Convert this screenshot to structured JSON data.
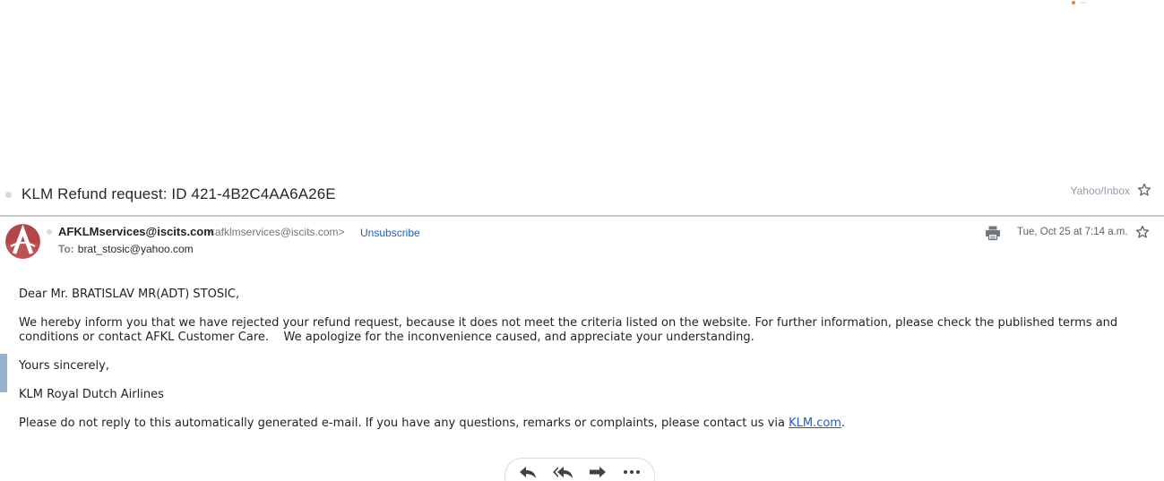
{
  "message": {
    "subject": "KLM Refund request: ID 421-4B2C4AA6A26E",
    "folder": "Yahoo/Inbox",
    "sender_name": "AFKLMservices@iscits.com",
    "sender_email": "<afklmservices@iscits.com>",
    "unsubscribe_label": "Unsubscribe",
    "to_label": "To:",
    "to_address": "brat_stosic@yahoo.com",
    "date": "Tue, Oct 25 at 7:14 a.m."
  },
  "body": {
    "greeting": "Dear Mr. BRATISLAV MR(ADT) STOSIC,",
    "paragraph1": "We hereby inform you that we have rejected your refund request, because it does not meet the criteria listed on the website. For further information, please check the published terms and conditions or contact AFKL Customer Care.    We apologize for the inconvenience caused, and appreciate your understanding.",
    "closing": "Yours sincerely,",
    "signature": "KLM Royal Dutch Airlines",
    "footer_text": "Please do not reply to this automatically generated e-mail. If you have any questions, remarks or complaints, please contact us via ",
    "footer_link": "KLM.com",
    "footer_end": "."
  },
  "icons": {
    "star": "star-icon",
    "print": "print-icon",
    "reply": "reply-icon",
    "reply_all": "reply-all-icon",
    "forward": "forward-icon",
    "more": "more-icon"
  },
  "colors": {
    "link": "#1e5ec2",
    "avatar_bg": "#b4464b"
  }
}
